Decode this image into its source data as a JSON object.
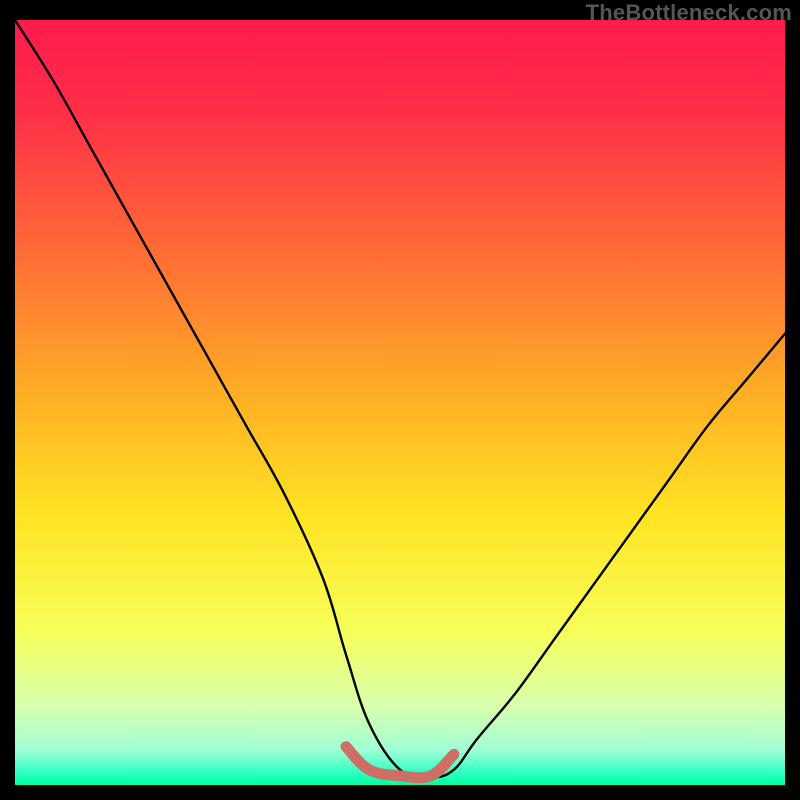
{
  "watermark": {
    "text": "TheBottleneck.com"
  },
  "colors": {
    "black": "#000000",
    "curve": "#000000",
    "highlight": "#cd6f67",
    "gradient_stops": [
      {
        "offset": 0.0,
        "color": "#ff1a4d"
      },
      {
        "offset": 0.12,
        "color": "#ff2f48"
      },
      {
        "offset": 0.3,
        "color": "#ff6a36"
      },
      {
        "offset": 0.5,
        "color": "#ffb224"
      },
      {
        "offset": 0.65,
        "color": "#ffe423"
      },
      {
        "offset": 0.8,
        "color": "#f6ff5a"
      },
      {
        "offset": 0.9,
        "color": "#d6ffb0"
      },
      {
        "offset": 0.955,
        "color": "#9effd4"
      },
      {
        "offset": 0.985,
        "color": "#2bffc0"
      },
      {
        "offset": 1.0,
        "color": "#00ff9c"
      }
    ]
  },
  "chart_data": {
    "type": "line",
    "title": "",
    "xlabel": "",
    "ylabel": "",
    "xlim": [
      0,
      100
    ],
    "ylim": [
      0,
      100
    ],
    "grid": false,
    "legend_position": "none",
    "annotations": [
      "TheBottleneck.com"
    ],
    "series": [
      {
        "name": "bottleneck-curve",
        "x": [
          0,
          5,
          10,
          15,
          20,
          25,
          30,
          35,
          40,
          43,
          46,
          50,
          54,
          57,
          60,
          65,
          70,
          75,
          80,
          85,
          90,
          95,
          100
        ],
        "y": [
          100,
          92,
          83,
          74,
          65,
          56,
          47,
          38,
          27,
          17,
          8,
          2,
          1,
          2,
          6,
          12,
          19,
          26,
          33,
          40,
          47,
          53,
          59
        ]
      },
      {
        "name": "highlight-segment",
        "x": [
          43,
          46,
          50,
          54,
          57
        ],
        "y": [
          5,
          2,
          1.2,
          1.2,
          4
        ]
      }
    ]
  }
}
